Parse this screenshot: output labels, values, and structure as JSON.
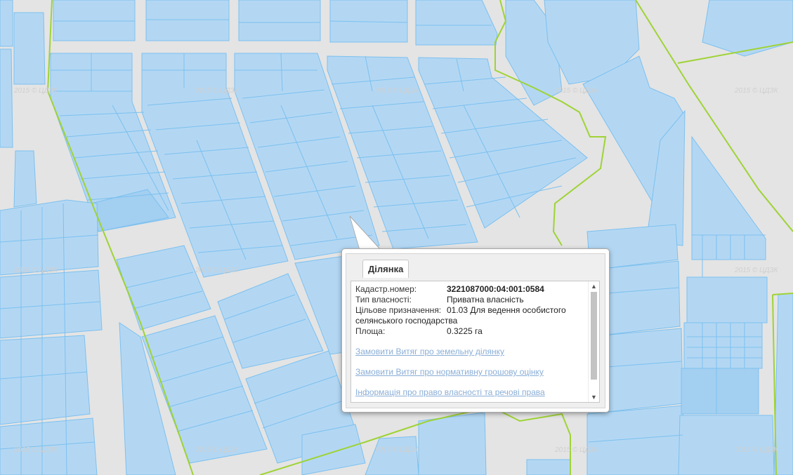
{
  "watermark": "2015 © ЦДЗК",
  "popup": {
    "tab_label": "Ділянка",
    "close_glyph": "×",
    "fields": [
      {
        "label": "Кадастр.номер:",
        "value": "3221087000:04:001:0584"
      },
      {
        "label": "Тип власності:",
        "value": "Приватна власність"
      },
      {
        "label": "Цільове призначення:",
        "value": "01.03 Для ведення особистого"
      },
      {
        "label": "",
        "value": "селянського господарства"
      },
      {
        "label": "Площа:",
        "value": "0.3225 га"
      }
    ],
    "links": [
      "Замовити Витяг про земельну ділянку",
      "Замовити Витяг про нормативну грошову оцінку",
      "Інформація про право власності та речові права"
    ],
    "scroll_up_glyph": "▲",
    "scroll_down_glyph": "▼"
  },
  "colors": {
    "background": "#e4e4e4",
    "parcel_fill": "#b3d7f3",
    "parcel_stroke": "#7cc0ef",
    "boundary_line": "#9fd335",
    "link": "#8aaed6"
  }
}
